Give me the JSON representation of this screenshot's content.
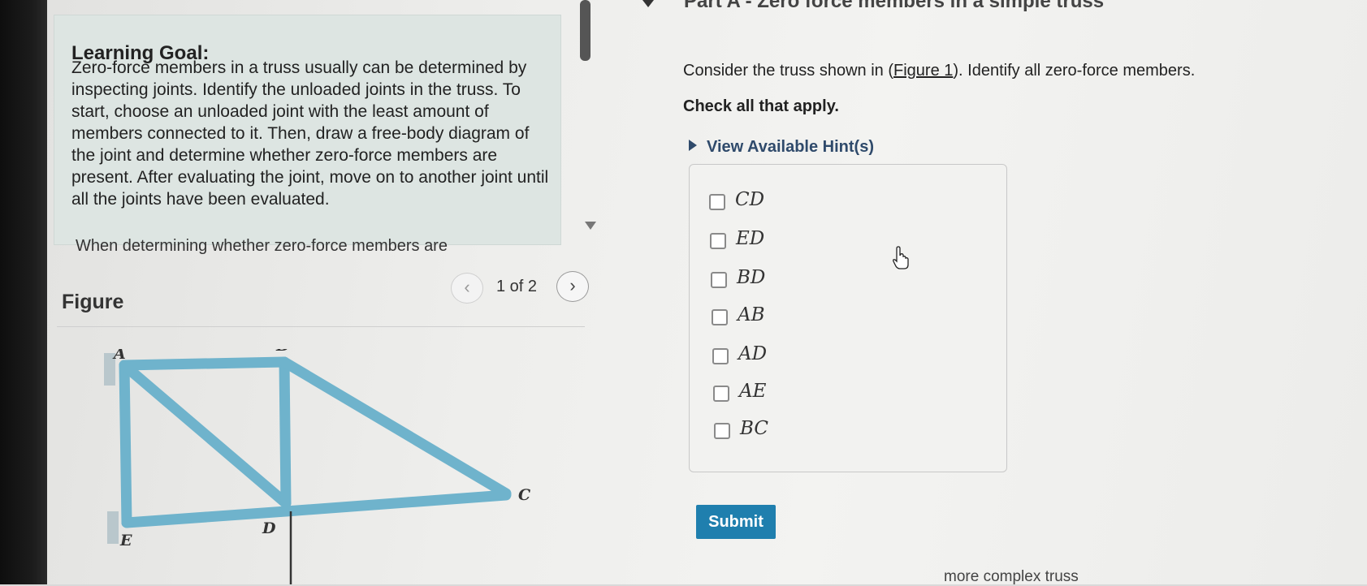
{
  "learning_goal": {
    "title": "Learning Goal:",
    "text": "Zero-force members in a truss usually can be determined by inspecting joints. Identify the unloaded joints in the truss. To start, choose an unloaded joint with the least amount of members connected to it. Then, draw a free-body diagram of the joint and determine whether zero-force members are present. After evaluating the joint, move on to another joint until all the joints have been evaluated.",
    "continuation": "When determining whether zero-force members are"
  },
  "figure": {
    "title": "Figure",
    "pager_label": "1 of 2",
    "prev_icon": "chevron-left-icon",
    "next_icon": "chevron-right-icon",
    "joint_labels": {
      "A": "A",
      "B": "B",
      "C": "C",
      "D": "D",
      "E": "E"
    },
    "member_color": "#6fb3cc"
  },
  "part": {
    "title": "Part A - Zero force members in a simple truss",
    "prompt_before": "Consider the truss shown in (",
    "prompt_link": "Figure 1",
    "prompt_after": "). Identify all zero-force members.",
    "instruction": "Check all that apply.",
    "hint_label": "View Available Hint(s)",
    "options": [
      "CD",
      "ED",
      "BD",
      "AB",
      "AD",
      "AE",
      "BC"
    ],
    "submit_label": "Submit"
  },
  "footer_text": "more complex truss",
  "colors": {
    "submit_bg": "#1f7fae",
    "hint_text": "#2f4a6b",
    "goal_bg": "#dde5e2"
  }
}
